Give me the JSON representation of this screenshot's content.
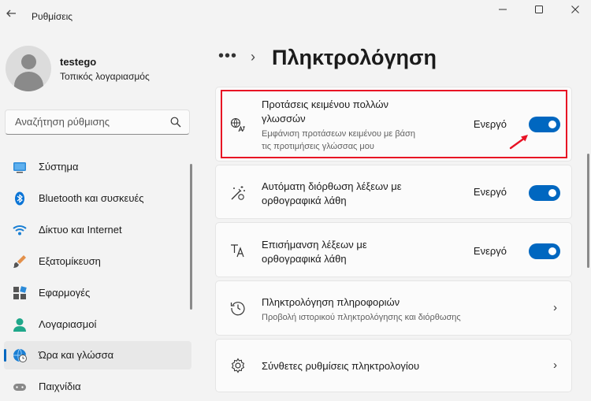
{
  "window": {
    "title": "Ρυθμίσεις",
    "back_icon": "arrow-left-icon",
    "controls": [
      "minimize-icon",
      "maximize-icon",
      "close-icon"
    ]
  },
  "user": {
    "name": "testego",
    "account_type": "Τοπικός λογαριασμός"
  },
  "search": {
    "placeholder": "Αναζήτηση ρύθμισης"
  },
  "sidebar": {
    "items": [
      {
        "label": "Σύστημα",
        "icon": "system-icon",
        "selected": false
      },
      {
        "label": "Bluetooth και συσκευές",
        "icon": "bluetooth-icon",
        "selected": false
      },
      {
        "label": "Δίκτυο και Internet",
        "icon": "wifi-icon",
        "selected": false
      },
      {
        "label": "Εξατομίκευση",
        "icon": "brush-icon",
        "selected": false
      },
      {
        "label": "Εφαρμογές",
        "icon": "apps-icon",
        "selected": false
      },
      {
        "label": "Λογαριασμοί",
        "icon": "account-icon",
        "selected": false
      },
      {
        "label": "Ώρα και γλώσσα",
        "icon": "time-language-icon",
        "selected": true
      },
      {
        "label": "Παιχνίδια",
        "icon": "gaming-icon",
        "selected": false
      }
    ]
  },
  "header": {
    "breadcrumb_more": "•••",
    "breadcrumb_separator": "›",
    "title": "Πληκτρολόγηση"
  },
  "settings": [
    {
      "title": "Προτάσεις κειμένου πολλών γλωσσών",
      "description": "Εμφάνιση προτάσεων κειμένου με βάση τις προτιμήσεις γλώσσας μου",
      "state": "Ενεργό",
      "toggle": true,
      "icon": "multilingual-icon"
    },
    {
      "title": "Αυτόματη διόρθωση λέξεων με ορθογραφικά λάθη",
      "state": "Ενεργό",
      "toggle": true,
      "icon": "autocorrect-icon"
    },
    {
      "title": "Επισήμανση λέξεων με ορθογραφικά λάθη",
      "state": "Ενεργό",
      "toggle": true,
      "icon": "spellcheck-icon"
    },
    {
      "title": "Πληκτρολόγηση πληροφοριών",
      "description": "Προβολή ιστορικού πληκτρολόγησης και διόρθωσης",
      "icon": "history-icon",
      "chevron": "›"
    },
    {
      "title": "Σύνθετες ρυθμίσεις πληκτρολογίου",
      "icon": "gear-icon",
      "chevron": "›"
    }
  ],
  "colors": {
    "accent": "#0067c0",
    "highlight": "#e81224"
  }
}
